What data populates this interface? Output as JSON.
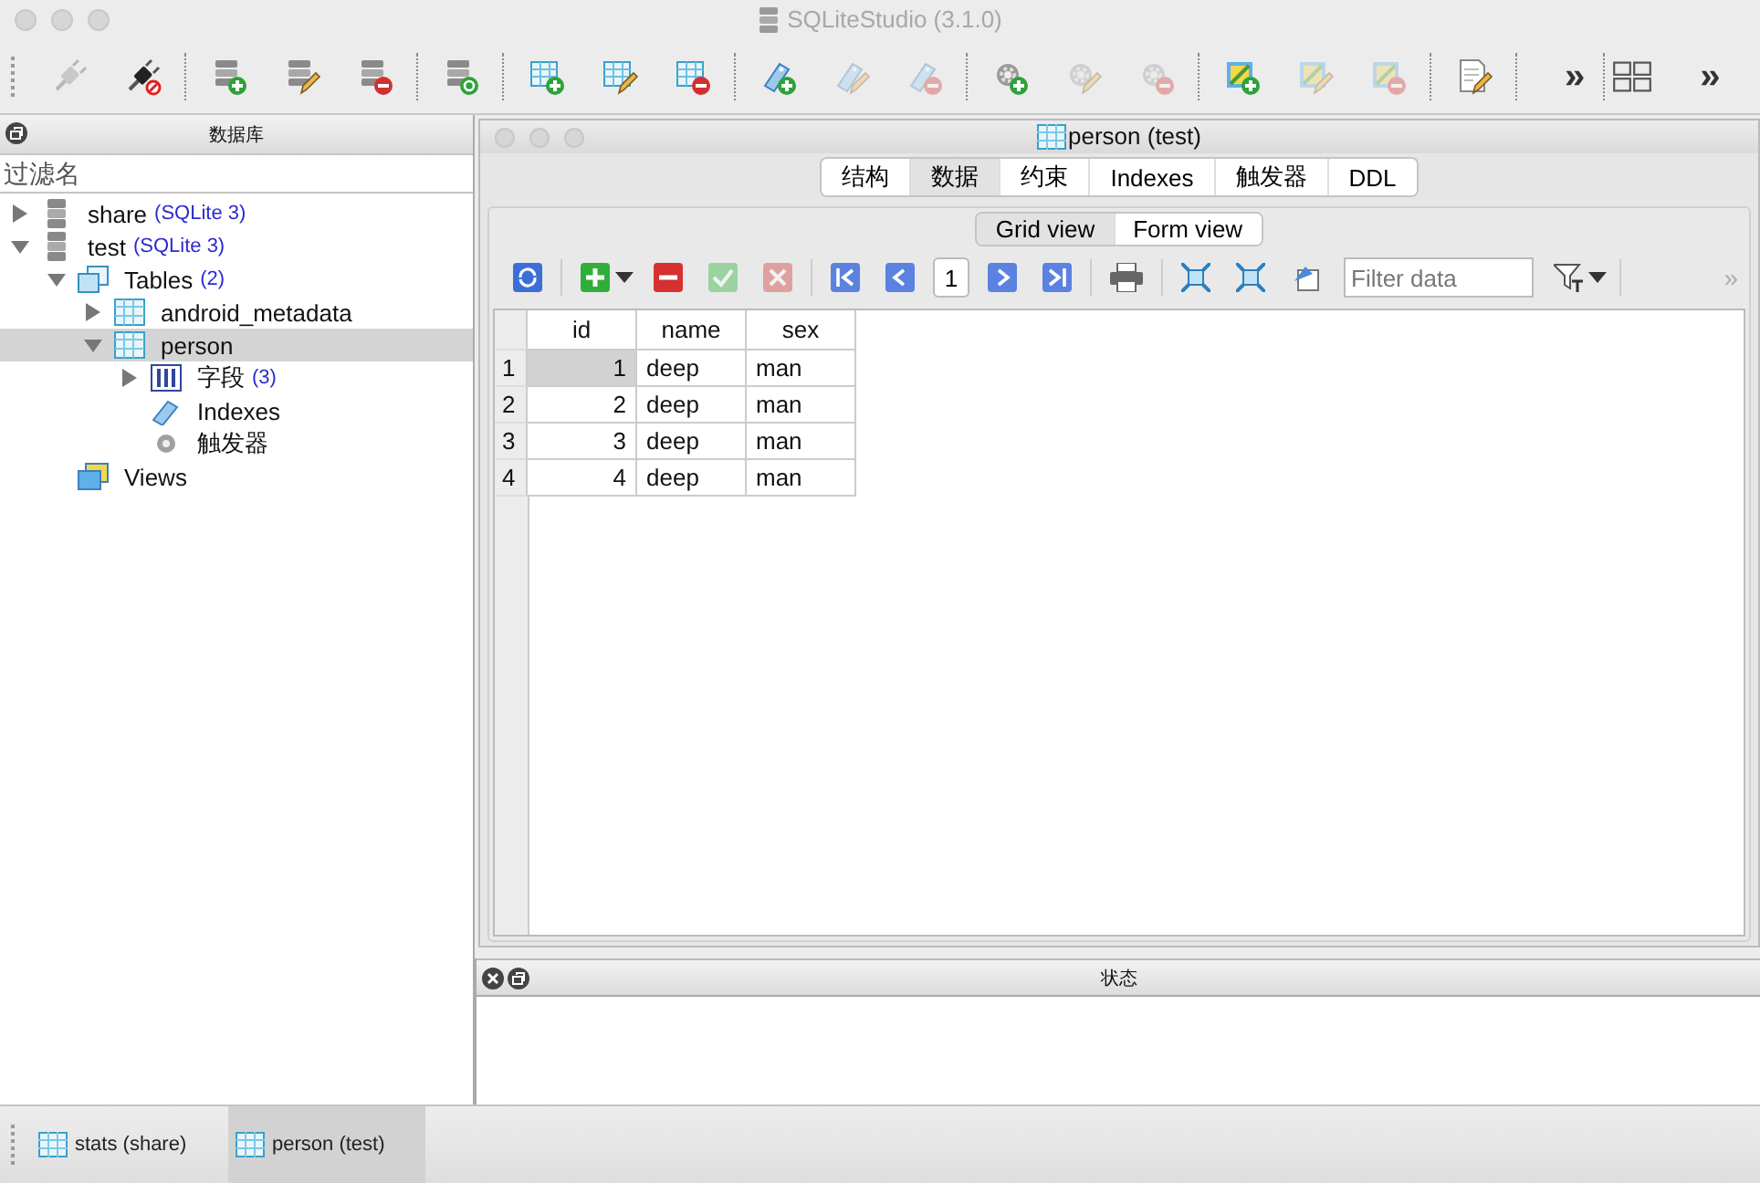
{
  "app": {
    "title": "SQLiteStudio (3.1.0)"
  },
  "toolbar": {
    "groups": [
      [
        {
          "kind": "plug",
          "disabled": true
        },
        {
          "kind": "plug-block",
          "disabled": false
        }
      ],
      [
        {
          "kind": "database-add",
          "disabled": false
        },
        {
          "kind": "database-edit",
          "disabled": false
        },
        {
          "kind": "database-remove",
          "disabled": false
        }
      ],
      [
        {
          "kind": "database-refresh",
          "disabled": false
        }
      ],
      [
        {
          "kind": "table-add",
          "disabled": false
        },
        {
          "kind": "table-edit",
          "disabled": false
        },
        {
          "kind": "table-remove",
          "disabled": false
        }
      ],
      [
        {
          "kind": "tag-add",
          "disabled": false
        },
        {
          "kind": "tag-edit",
          "disabled": true
        },
        {
          "kind": "tag-remove",
          "disabled": true
        }
      ],
      [
        {
          "kind": "gear-add",
          "disabled": false
        },
        {
          "kind": "gear-edit",
          "disabled": true
        },
        {
          "kind": "gear-remove",
          "disabled": true
        }
      ],
      [
        {
          "kind": "view-add",
          "disabled": false
        },
        {
          "kind": "view-edit",
          "disabled": true
        },
        {
          "kind": "view-remove",
          "disabled": true
        }
      ],
      [
        {
          "kind": "document-edit",
          "disabled": false
        }
      ]
    ],
    "more": "»",
    "more_2": "»"
  },
  "databases_panel": {
    "title": "数据库",
    "filter": {
      "placeholder": "过滤名"
    },
    "tree": [
      {
        "kind": "database",
        "label": "share",
        "note": "(SQLite 3)",
        "expanded": false,
        "selected": false
      },
      {
        "kind": "database",
        "label": "test",
        "note": "(SQLite 3)",
        "expanded": true,
        "selected": false,
        "children": [
          {
            "kind": "tables",
            "label": "Tables",
            "note": "(2)",
            "expanded": true,
            "selected": false,
            "children": [
              {
                "kind": "table",
                "label": "android_metadata",
                "expanded": false,
                "selected": false
              },
              {
                "kind": "table",
                "label": "person",
                "expanded": true,
                "selected": true,
                "children": [
                  {
                    "kind": "columns",
                    "label": "字段",
                    "note": "(3)",
                    "expanded": false,
                    "selected": false
                  },
                  {
                    "kind": "index",
                    "label": "Indexes",
                    "selected": false
                  },
                  {
                    "kind": "trigger",
                    "label": "触发器",
                    "selected": false
                  }
                ]
              }
            ]
          },
          {
            "kind": "views",
            "label": "Views",
            "selected": false
          }
        ]
      }
    ]
  },
  "window": {
    "title": "person (test)",
    "tabs": [
      {
        "label": "结构",
        "selected": false
      },
      {
        "label": "数据",
        "selected": true
      },
      {
        "label": "约束",
        "selected": false
      },
      {
        "label": "Indexes",
        "selected": false
      },
      {
        "label": "触发器",
        "selected": false
      },
      {
        "label": "DDL",
        "selected": false
      }
    ],
    "view_tabs": [
      {
        "label": "Grid view",
        "selected": true
      },
      {
        "label": "Form view",
        "selected": false
      }
    ],
    "data_toolbar": [
      {
        "kind": "refresh",
        "disabled": false
      },
      {
        "kind": "sep"
      },
      {
        "kind": "add",
        "disabled": false
      },
      {
        "kind": "caret",
        "disabled": false
      },
      {
        "kind": "delete",
        "disabled": false
      },
      {
        "kind": "commit",
        "disabled": true
      },
      {
        "kind": "rollback",
        "disabled": true
      },
      {
        "kind": "sep"
      },
      {
        "kind": "first",
        "disabled": false
      },
      {
        "kind": "prev",
        "disabled": false
      },
      {
        "kind": "page",
        "value": "1"
      },
      {
        "kind": "next",
        "disabled": false
      },
      {
        "kind": "last",
        "disabled": false
      },
      {
        "kind": "sep"
      },
      {
        "kind": "print",
        "disabled": false
      },
      {
        "kind": "sep"
      },
      {
        "kind": "expand",
        "disabled": false
      },
      {
        "kind": "shrink",
        "disabled": false
      },
      {
        "kind": "export",
        "disabled": false
      },
      {
        "kind": "filter",
        "placeholder": "Filter data"
      },
      {
        "kind": "filter-mode",
        "disabled": false
      },
      {
        "kind": "caret",
        "disabled": false
      },
      {
        "kind": "sep"
      }
    ],
    "more": "»",
    "grid": {
      "columns": [
        "id",
        "name",
        "sex"
      ],
      "rows": [
        {
          "number": "1",
          "cells": [
            {
              "text": "1",
              "selected": true
            },
            {
              "text": "deep",
              "selected": false
            },
            {
              "text": "man",
              "selected": false
            }
          ]
        },
        {
          "number": "2",
          "cells": [
            {
              "text": "2",
              "selected": false
            },
            {
              "text": "deep",
              "selected": false
            },
            {
              "text": "man",
              "selected": false
            }
          ]
        },
        {
          "number": "3",
          "cells": [
            {
              "text": "3",
              "selected": false
            },
            {
              "text": "deep",
              "selected": false
            },
            {
              "text": "man",
              "selected": false
            }
          ]
        },
        {
          "number": "4",
          "cells": [
            {
              "text": "4",
              "selected": false
            },
            {
              "text": "deep",
              "selected": false
            },
            {
              "text": "man",
              "selected": false
            }
          ]
        }
      ]
    }
  },
  "status_panel": {
    "title": "状态"
  },
  "window_tabs": [
    {
      "label": "stats (share)",
      "selected": false
    },
    {
      "label": "person (test)",
      "selected": true
    }
  ]
}
